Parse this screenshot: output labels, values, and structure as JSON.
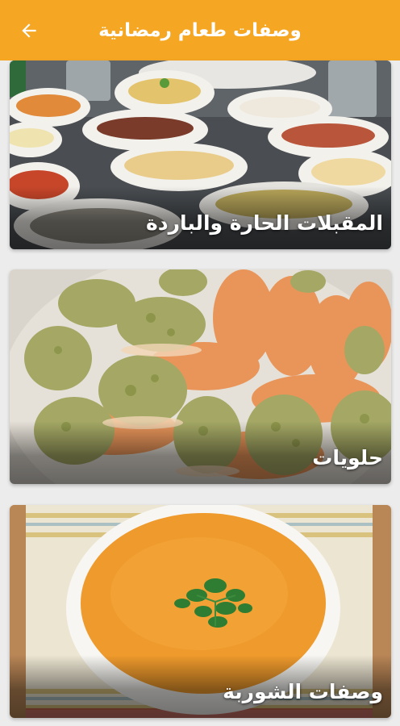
{
  "appbar": {
    "title": "وصفات طعام رمضانية",
    "back_icon": "arrow-left-icon",
    "background_color": "#f5a623"
  },
  "categories": [
    {
      "label": "المقبلات الحارة والباردة",
      "image": "appetizers-spread-photo"
    },
    {
      "label": "حلويات",
      "image": "qatayef-pistachio-photo"
    },
    {
      "label": "وصفات الشوربة",
      "image": "lentil-soup-bowl-photo"
    }
  ]
}
